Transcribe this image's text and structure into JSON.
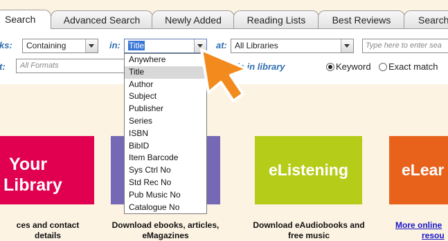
{
  "tabs": [
    {
      "label": "Search",
      "active": true
    },
    {
      "label": "Advanced Search",
      "active": false
    },
    {
      "label": "Newly Added",
      "active": false
    },
    {
      "label": "Reading Lists",
      "active": false
    },
    {
      "label": "Best Reviews",
      "active": false
    },
    {
      "label": "Search",
      "active": false
    }
  ],
  "filters": {
    "words_label": "ks:",
    "words_value": "Containing",
    "in_label": "in:",
    "in_value": "Title",
    "at_label": "at:",
    "at_value": "All Libraries",
    "search_placeholder": "Type here to enter sea",
    "format_label": "t:",
    "format_value": "All Formats",
    "availability_text": "able in library",
    "match_options": [
      {
        "label": "Keyword",
        "selected": true
      },
      {
        "label": "Exact match",
        "selected": false
      }
    ]
  },
  "dropdown": {
    "options": [
      "Anywhere",
      "Title",
      "Author",
      "Subject",
      "Publisher",
      "Series",
      "ISBN",
      "BibID",
      "Item Barcode",
      "Sys Ctrl No",
      "Std Rec No",
      "Pub Music No",
      "Catalogue No"
    ],
    "selected": "Title"
  },
  "tiles": [
    {
      "line1": "Your",
      "line2": "Library",
      "color": "#e0004f"
    },
    {
      "line1": "",
      "line2": "",
      "color": "#7568b4"
    },
    {
      "line1": "eListening",
      "line2": "",
      "color": "#b5cc18"
    },
    {
      "line1": "eLear",
      "line2": "",
      "color": "#e8621c"
    }
  ],
  "captions": [
    {
      "line1": "ces and contact",
      "line2": "details"
    },
    {
      "line1": "Download ebooks, articles,",
      "line2": "eMagazines"
    },
    {
      "line1": "Download eAudiobooks and",
      "line2": "free music"
    },
    {
      "line1": "More online",
      "line2": "resou"
    }
  ],
  "colors": {
    "accent_blue": "#2f6db0",
    "pointer_orange": "#f28a1e",
    "page_background": "#fdf3e3",
    "link_blue": "#1515c8"
  },
  "icons": {
    "pointer": "cursor-arrow-icon",
    "dropdown": "chevron-down-icon"
  }
}
